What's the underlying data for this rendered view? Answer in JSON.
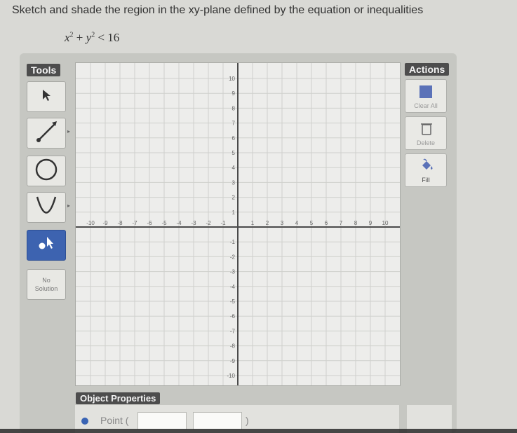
{
  "instruction": "Sketch and shade the region in the xy-plane defined by the equation or inequalities",
  "equation": {
    "x": "x",
    "y": "y",
    "exp": "2",
    "plus": "+",
    "rest": "< 16"
  },
  "tools": {
    "label": "Tools",
    "items": [
      {
        "name": "select-tool",
        "icon": "arrow-cursor-icon"
      },
      {
        "name": "line-tool",
        "icon": "line-segment-icon"
      },
      {
        "name": "circle-tool",
        "icon": "circle-icon"
      },
      {
        "name": "parabola-tool",
        "icon": "parabola-icon"
      },
      {
        "name": "point-tool",
        "icon": "point-icon",
        "active": true
      }
    ],
    "no_solution_line1": "No",
    "no_solution_line2": "Solution"
  },
  "actions": {
    "label": "Actions",
    "clear_all": "Clear All",
    "delete": "Delete",
    "fill": "Fill"
  },
  "graph": {
    "x_ticks": [
      "-10",
      "-9",
      "-8",
      "-7",
      "-6",
      "-5",
      "-4",
      "-3",
      "-2",
      "-1",
      "1",
      "2",
      "3",
      "4",
      "5",
      "6",
      "7",
      "8",
      "9",
      "10"
    ],
    "y_ticks": [
      "10",
      "9",
      "8",
      "7",
      "6",
      "5",
      "4",
      "3",
      "2",
      "1",
      "-1",
      "-2",
      "-3",
      "-4",
      "-5",
      "-6",
      "-7",
      "-8",
      "-9",
      "-10"
    ],
    "range": [
      -10,
      10
    ]
  },
  "object_properties": {
    "label": "Object Properties",
    "point_label": "Point (",
    "close_paren": ")"
  },
  "colors": {
    "accent": "#3d63b0",
    "label_bg": "#4d4d4d",
    "grid": "#cfd0cc",
    "axis": "#4a4a4a"
  }
}
